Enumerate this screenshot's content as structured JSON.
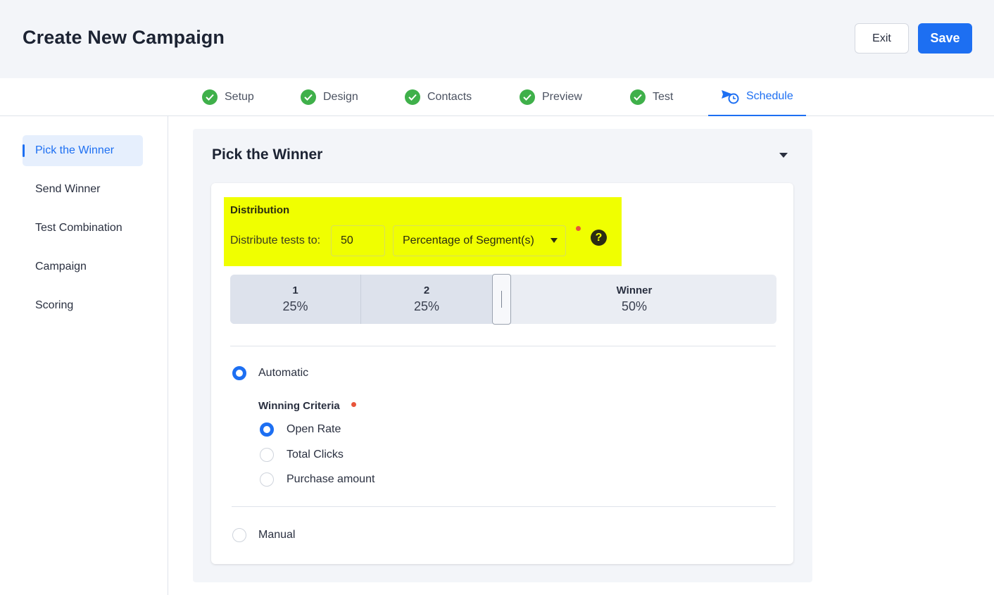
{
  "header": {
    "title": "Create New Campaign",
    "exit_label": "Exit",
    "save_label": "Save"
  },
  "tabs": [
    {
      "label": "Setup",
      "status": "complete"
    },
    {
      "label": "Design",
      "status": "complete"
    },
    {
      "label": "Contacts",
      "status": "complete"
    },
    {
      "label": "Preview",
      "status": "complete"
    },
    {
      "label": "Test",
      "status": "complete"
    },
    {
      "label": "Schedule",
      "status": "active"
    }
  ],
  "sidebar": {
    "items": [
      {
        "label": "Pick the Winner",
        "active": true
      },
      {
        "label": "Send Winner",
        "active": false
      },
      {
        "label": "Test Combination",
        "active": false
      },
      {
        "label": "Campaign",
        "active": false
      },
      {
        "label": "Scoring",
        "active": false
      }
    ]
  },
  "panel": {
    "title": "Pick the Winner",
    "distribution": {
      "title": "Distribution",
      "label": "Distribute tests to:",
      "value": "50",
      "unit_selected": "Percentage of Segment(s)"
    },
    "split": [
      {
        "name": "1",
        "percent": "25%"
      },
      {
        "name": "2",
        "percent": "25%"
      },
      {
        "name": "Winner",
        "percent": "50%"
      }
    ],
    "mode_automatic": "Automatic",
    "winning_criteria_title": "Winning Criteria",
    "criteria": [
      {
        "label": "Open Rate",
        "selected": true
      },
      {
        "label": "Total Clicks",
        "selected": false
      },
      {
        "label": "Purchase amount",
        "selected": false
      }
    ],
    "mode_manual": "Manual",
    "selected_mode": "Automatic"
  },
  "colors": {
    "accent": "#1d6ff2",
    "success": "#3fb04a",
    "highlight": "#f0ff00",
    "required": "#e8543a"
  }
}
